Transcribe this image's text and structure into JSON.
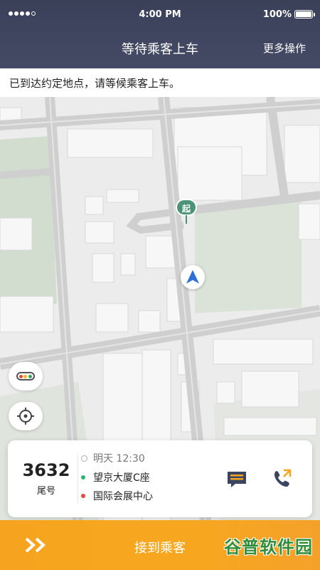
{
  "status_bar": {
    "time": "4:00 PM",
    "battery": "100%"
  },
  "nav": {
    "title": "等待乘客上车",
    "more_label": "更多操作"
  },
  "notice": {
    "text": "已到达约定地点，请等候乘客上车。"
  },
  "map": {
    "start_marker_label": "起",
    "controls": {
      "traffic_colors": [
        "#e04b3a",
        "#f2b51f",
        "#3aa55a"
      ]
    }
  },
  "order_card": {
    "tail_number": "3632",
    "tail_label": "尾号",
    "time": "明天 12:30",
    "from": "望京大厦C座",
    "to": "国际会展中心",
    "from_color": "#2fb56a",
    "to_color": "#e04b3a"
  },
  "bottom_bar": {
    "action_label": "接到乘客",
    "watermark": "谷普软件园"
  },
  "colors": {
    "header": "#3f455f",
    "accent": "#f6a41f",
    "start_pin": "#4c9478",
    "nav_arrow": "#2d6fd6"
  }
}
